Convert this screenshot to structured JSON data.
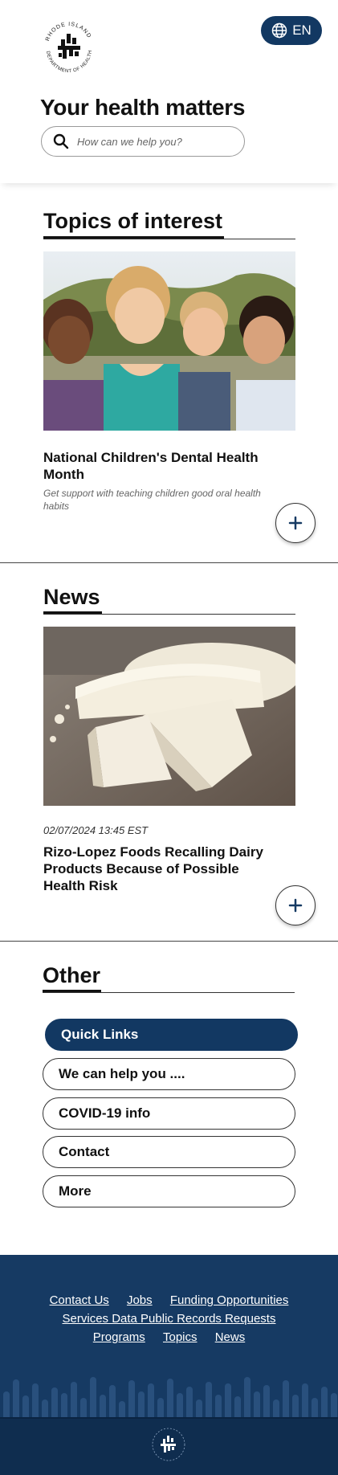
{
  "header": {
    "seal_text": "RHODE ISLAND DEPARTMENT OF HEALTH",
    "language_label": "EN",
    "title": "Your health matters",
    "search_placeholder": "How can we help you?"
  },
  "topics": {
    "heading": "Topics of interest",
    "card": {
      "title": "National Children's Dental Health Month",
      "subtitle": "Get support with teaching children good oral health habits",
      "expand_label": "+"
    }
  },
  "news": {
    "heading": "News",
    "card": {
      "date": "02/07/2024 13:45 EST",
      "title": "Rizo-Lopez Foods Recalling Dairy Products Because of Possible Health Risk",
      "expand_label": "+"
    }
  },
  "other": {
    "heading": "Other",
    "links": [
      {
        "label": "Quick Links"
      },
      {
        "label": "We can help you ...."
      },
      {
        "label": "COVID-19 info"
      },
      {
        "label": "Contact"
      },
      {
        "label": "More"
      }
    ]
  },
  "footer": {
    "links_row1": [
      "Contact Us",
      "Jobs",
      "Funding Opportunities"
    ],
    "links_row2": [
      "Services Data Public Records Requests"
    ],
    "links_row3": [
      "Programs",
      "Topics",
      "News"
    ]
  },
  "colors": {
    "brand_navy": "#123862",
    "footer_navy": "#163a63"
  }
}
